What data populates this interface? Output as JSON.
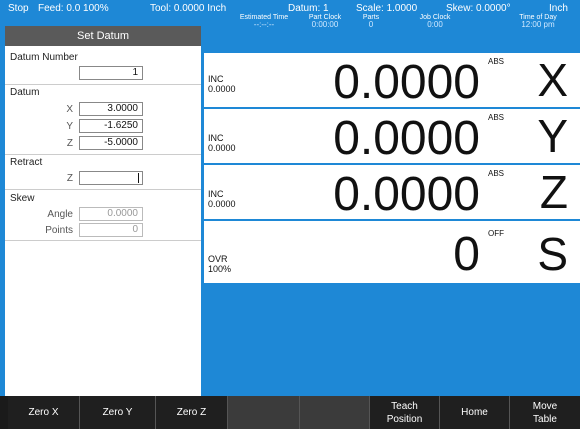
{
  "status": {
    "state": "Stop",
    "feed": "Feed:  0.0 100%",
    "tool": "Tool: 0.0000 Inch",
    "datum": "Datum: 1",
    "scale": "Scale: 1.0000",
    "skew": "Skew: 0.0000°",
    "units": "Inch",
    "estimated_time_label": "Estimated Time",
    "estimated_time_value": "--:--:--",
    "part_clock_label": "Part Clock",
    "part_clock_value": "0:00:00",
    "parts_label": "Parts",
    "parts_value": "0",
    "job_clock_label": "Job Clock",
    "job_clock_value": "0:00",
    "time_of_day_label": "Time of Day",
    "time_of_day_value": "12:00 pm"
  },
  "side_panel": {
    "title": "Set Datum",
    "datum_number_label": "Datum Number",
    "datum_number_value": "1",
    "datum_label": "Datum",
    "datum_x_label": "X",
    "datum_x_value": "3.0000",
    "datum_y_label": "Y",
    "datum_y_value": "-1.6250",
    "datum_z_label": "Z",
    "datum_z_value": "-5.0000",
    "retract_label": "Retract",
    "retract_z_label": "Z",
    "retract_z_value": "",
    "skew_label": "Skew",
    "skew_angle_label": "Angle",
    "skew_angle_value": "0.0000",
    "skew_points_label": "Points",
    "skew_points_value": "0"
  },
  "axes": [
    {
      "mode": "INC",
      "inc_value": "0.0000",
      "value": "0.0000",
      "tag": "ABS",
      "letter": "X"
    },
    {
      "mode": "INC",
      "inc_value": "0.0000",
      "value": "0.0000",
      "tag": "ABS",
      "letter": "Y"
    },
    {
      "mode": "INC",
      "inc_value": "0.0000",
      "value": "0.0000",
      "tag": "ABS",
      "letter": "Z"
    },
    {
      "mode": "OVR",
      "inc_value": "100%",
      "value": "0",
      "tag": "OFF",
      "letter": "S"
    }
  ],
  "softkeys": {
    "zero_x": "Zero X",
    "zero_y": "Zero Y",
    "zero_z": "Zero Z",
    "teach_1": "Teach",
    "teach_2": "Position",
    "home": "Home",
    "move_1": "Move",
    "move_2": "Table"
  },
  "colors": {
    "background": "#1e88d6",
    "panel": "#ffffff",
    "header": "#5a5a5a",
    "softkey_bar": "#1a1a1a"
  }
}
